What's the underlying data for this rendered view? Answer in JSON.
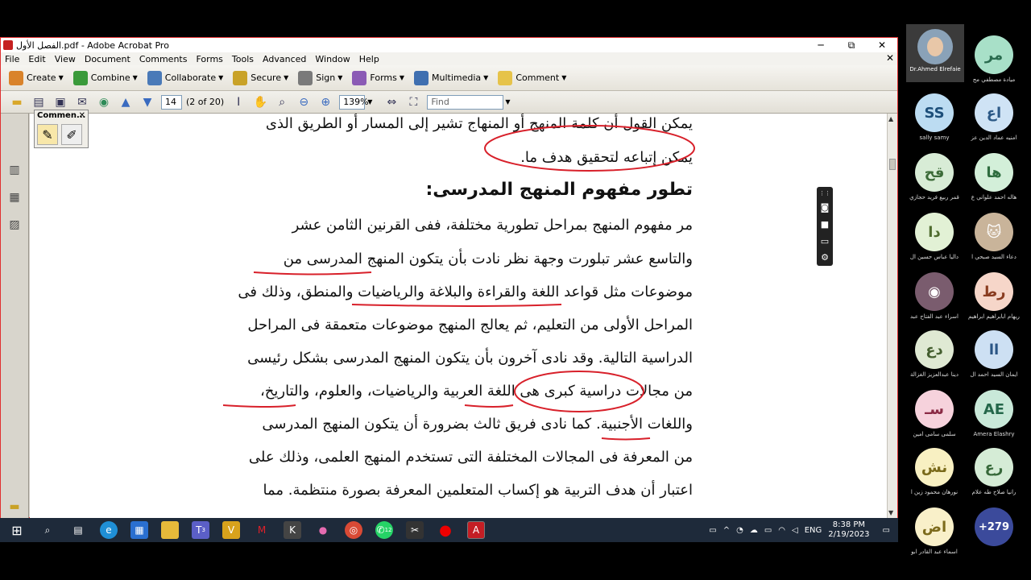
{
  "window": {
    "title": "الفصل الأول.pdf - Adobe Acrobat Pro",
    "min": "─",
    "restore": "⧉",
    "close": "✕"
  },
  "menu": {
    "items": [
      "File",
      "Edit",
      "View",
      "Document",
      "Comments",
      "Forms",
      "Tools",
      "Advanced",
      "Window",
      "Help"
    ],
    "close_doc": "✕"
  },
  "toolbar1": {
    "items": [
      {
        "label": "Create",
        "color": "#d9832b"
      },
      {
        "label": "Combine",
        "color": "#3a9a3a"
      },
      {
        "label": "Collaborate",
        "color": "#4a7ab8"
      },
      {
        "label": "Secure",
        "color": "#c9a227"
      },
      {
        "label": "Sign",
        "color": "#7a7a7a"
      },
      {
        "label": "Forms",
        "color": "#8b5bb5"
      },
      {
        "label": "Multimedia",
        "color": "#3f6fb0"
      },
      {
        "label": "Comment",
        "color": "#e6c34a"
      }
    ]
  },
  "toolbar2": {
    "page_number": "14",
    "page_of": "(2 of 20)",
    "zoom": "139%",
    "find_placeholder": "Find"
  },
  "comment_palette": {
    "title": "Commen...",
    "close": "✕"
  },
  "document": {
    "lines": [
      "يمكن القول أن كلمة المنهج أو المنهاج تشير إلى المسار أو الطريق الذى",
      "يمكن إتباعه لتحقيق هدف ما.",
      "تطور مفهوم المنهج المدرسى:",
      "مر مفهوم المنهج بمراحل تطورية مختلفة، ففى القرنين الثامن عشر",
      "والتاسع عشر تبلورت وجهة نظر نادت بأن يتكون المنهج المدرسى من",
      "موضوعات مثل قواعد اللغة والقراءة والبلاغة والرياضيات والمنطق، وذلك فى",
      "المراحل الأولى من التعليم، ثم يعالج المنهج موضوعات متعمقة فى المراحل",
      "الدراسية التالية. وقد نادى آخرون بأن يتكون المنهج المدرسى بشكل رئيسى",
      "من مجالات دراسية كبرى هى اللغة العربية والرياضيات، والعلوم، والتاريخ،",
      "واللغات الأجنبية. كما نادى فريق ثالث بضرورة أن يتكون المنهج المدرسى",
      "من المعرفة فى المجالات المختلفة التى تستخدم المنهج العلمى، وذلك على",
      "اعتبار أن هدف التربية هو إكساب المتعلمين المعرفة بصورة منتظمة. مما"
    ]
  },
  "taskbar": {
    "lang": "ENG",
    "time": "8:38 PM",
    "date": "2/19/2023",
    "teams_badge": "3",
    "whatsapp_badge": "12"
  },
  "participants": {
    "host": "Dr.Ahmed Elrefaie",
    "list": [
      {
        "initials": "مر",
        "name": "ميادة مصطفي مح",
        "bg": "#a8e0c8",
        "fg": "#2a6b4f"
      },
      {
        "initials": "SS",
        "name": "sally samy",
        "bg": "#bcdcf2",
        "fg": "#1d4f7a"
      },
      {
        "initials": "اع",
        "name": "امنيه عماد الدين عز",
        "bg": "#cfe3f5",
        "fg": "#2d5a87"
      },
      {
        "initials": "قح",
        "name": "قمر ربيع فريد حجازي",
        "bg": "#d8ecd6",
        "fg": "#3c6b38"
      },
      {
        "initials": "ها",
        "name": "هاله احمد علواني ع",
        "bg": "#d3efd9",
        "fg": "#2f6d3f"
      },
      {
        "initials": "دا",
        "name": "داليا عباس حسين ال",
        "bg": "#e2f1d5",
        "fg": "#4f6c2e"
      },
      {
        "initials": "",
        "name": "دعاء السيد صبحي ا",
        "bg": "#c9b49a",
        "fg": "#fff"
      },
      {
        "initials": "",
        "name": "اسراء عبد الفتاح عبد",
        "bg": "#7a5c6e",
        "fg": "#fff"
      },
      {
        "initials": "رط",
        "name": "ريهام ابابراهيم ابراهيم",
        "bg": "#f6d6c9",
        "fg": "#8a3c20"
      },
      {
        "initials": "دع",
        "name": "دينا عبدالعزيز الغزالة",
        "bg": "#dfe9d3",
        "fg": "#455f30"
      },
      {
        "initials": "اا",
        "name": "ايمان السيد احمد ال",
        "bg": "#cde0f3",
        "fg": "#2a5585"
      },
      {
        "initials": "سـ",
        "name": "سلمى سامى امين",
        "bg": "#f6d2dc",
        "fg": "#8a2a45"
      },
      {
        "initials": "AE",
        "name": "Amera Elashry",
        "bg": "#c9e9d9",
        "fg": "#24674a"
      },
      {
        "initials": "نش",
        "name": "نورهان محمود زين ا",
        "bg": "#f8f0c2",
        "fg": "#7a6a1a"
      },
      {
        "initials": "رع",
        "name": "رانيا صلاح طه علام",
        "bg": "#d5ecd6",
        "fg": "#37693a"
      },
      {
        "initials": "اض",
        "name": "اسماء عبد القادر ابو",
        "bg": "#f9f0c9",
        "fg": "#7d6b1c"
      },
      {
        "initials": "+279",
        "name": "",
        "bg": "#3b4a9b",
        "fg": "#ffffff"
      }
    ]
  }
}
